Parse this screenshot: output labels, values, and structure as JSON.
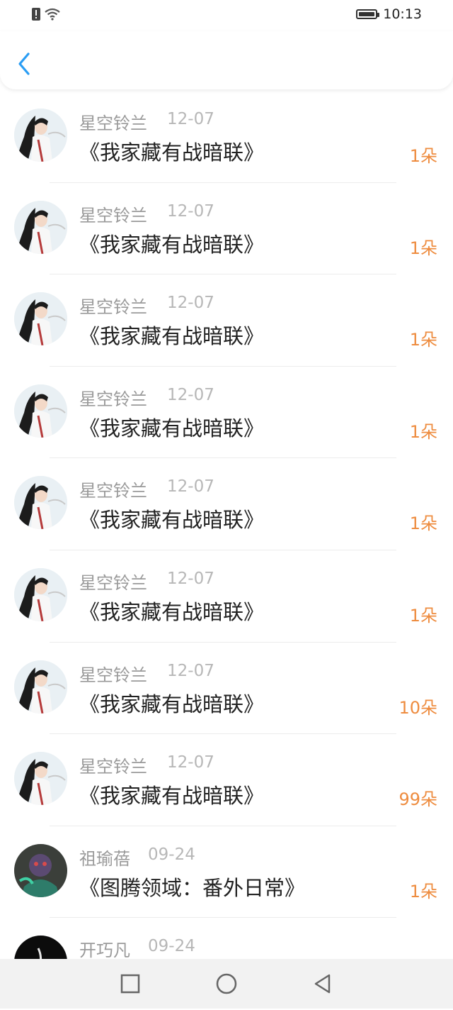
{
  "status": {
    "time": "10:13"
  },
  "colors": {
    "count": "#ee8c3f",
    "back": "#2a9df4"
  },
  "items": [
    {
      "name": "星空铃兰",
      "date": "12-07",
      "title": "《我家藏有战暗联》",
      "count": "1朵"
    },
    {
      "name": "星空铃兰",
      "date": "12-07",
      "title": "《我家藏有战暗联》",
      "count": "1朵"
    },
    {
      "name": "星空铃兰",
      "date": "12-07",
      "title": "《我家藏有战暗联》",
      "count": "1朵"
    },
    {
      "name": "星空铃兰",
      "date": "12-07",
      "title": "《我家藏有战暗联》",
      "count": "1朵"
    },
    {
      "name": "星空铃兰",
      "date": "12-07",
      "title": "《我家藏有战暗联》",
      "count": "1朵"
    },
    {
      "name": "星空铃兰",
      "date": "12-07",
      "title": "《我家藏有战暗联》",
      "count": "1朵"
    },
    {
      "name": "星空铃兰",
      "date": "12-07",
      "title": "《我家藏有战暗联》",
      "count": "10朵"
    },
    {
      "name": "星空铃兰",
      "date": "12-07",
      "title": "《我家藏有战暗联》",
      "count": "99朵"
    },
    {
      "name": "祖瑜蓓",
      "date": "09-24",
      "title": "《图腾领域：番外日常》",
      "count": "1朵"
    },
    {
      "name": "开巧凡",
      "date": "09-24",
      "title": "",
      "count": ""
    }
  ]
}
